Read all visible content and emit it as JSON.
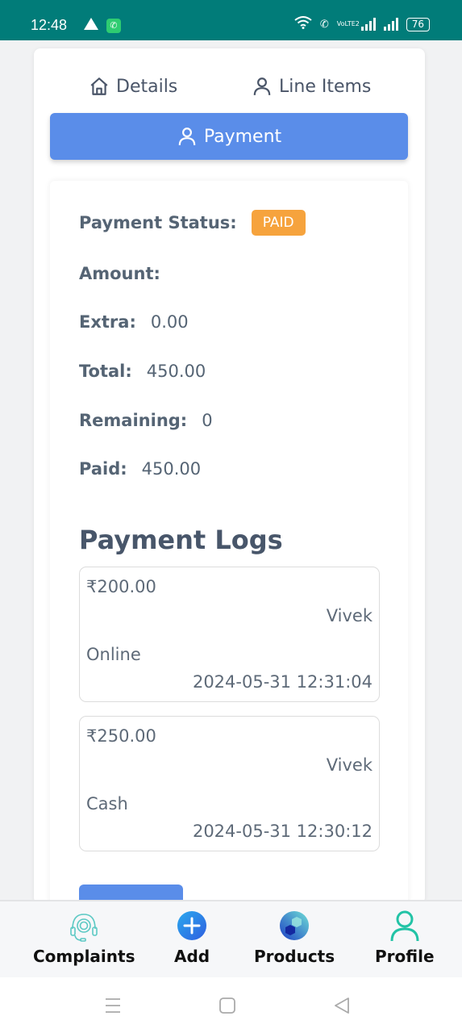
{
  "status_bar": {
    "time": "12:48",
    "network": "VoLTE2",
    "battery": "76"
  },
  "tabs": {
    "details": "Details",
    "line_items": "Line Items",
    "payment": "Payment"
  },
  "payment": {
    "status_label": "Payment Status:",
    "status_value": "PAID",
    "amount_label": "Amount:",
    "amount_value": "",
    "extra_label": "Extra:",
    "extra_value": "0.00",
    "total_label": "Total:",
    "total_value": "450.00",
    "remaining_label": "Remaining:",
    "remaining_value": "0",
    "paid_label": "Paid:",
    "paid_value": "450.00"
  },
  "logs": {
    "title": "Payment Logs",
    "items": [
      {
        "amount": "₹200.00",
        "user": "Vivek",
        "method": "Online",
        "date": "2024-05-31 12:31:04"
      },
      {
        "amount": "₹250.00",
        "user": "Vivek",
        "method": "Cash",
        "date": "2024-05-31 12:30:12"
      }
    ]
  },
  "bottom_nav": {
    "items": [
      {
        "label": "Complaints",
        "icon": "headset-gear-icon"
      },
      {
        "label": "Add",
        "icon": "plus-circle-icon"
      },
      {
        "label": "Products",
        "icon": "cubes-icon"
      },
      {
        "label": "Profile",
        "icon": "user-icon"
      }
    ]
  },
  "colors": {
    "status_bar": "#017c79",
    "accent": "#5a8de9",
    "badge": "#f6a33d"
  }
}
